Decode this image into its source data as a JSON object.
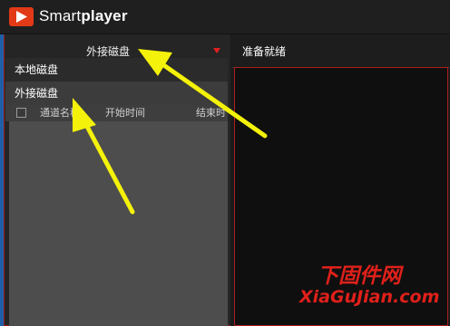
{
  "app": {
    "name_part1": "Smart",
    "name_part2": "player",
    "logo_icon": "play-icon"
  },
  "drive_selector": {
    "selected": "外接磁盘",
    "options": [
      "本地磁盘",
      "外接磁盘"
    ],
    "hovered_option": "外接磁盘"
  },
  "file_list": {
    "columns": [
      "通道名称",
      "开始时间",
      "结束时间"
    ]
  },
  "player": {
    "status": "准备就绪"
  },
  "watermark": {
    "cn": "下固件网",
    "en": "XiaGuJian.com"
  },
  "colors": {
    "accent_red": "#e02020",
    "annotation_arrow": "#f4f20a",
    "highlight_blue": "#1e5fa8"
  }
}
